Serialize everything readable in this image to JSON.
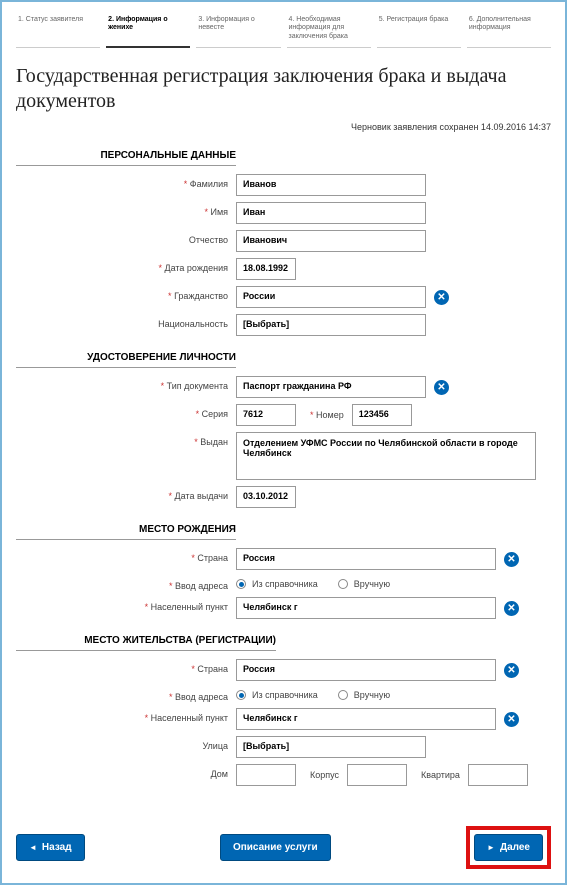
{
  "steps": [
    "1. Статус заявителя",
    "2. Информация о женихе",
    "3. Информация о невесте",
    "4. Необходимая информация для заключения брака",
    "5. Регистрация брака",
    "6. Дополнительная информация"
  ],
  "title": "Государственная регистрация заключения брака и выдача документов",
  "draft_saved": "Черновик заявления сохранен 14.09.2016 14:37",
  "sections": {
    "personal": "ПЕРСОНАЛЬНЫЕ ДАННЫЕ",
    "identity": "УДОСТОВЕРЕНИЕ ЛИЧНОСТИ",
    "birthplace": "МЕСТО РОЖДЕНИЯ",
    "residence": "МЕСТО ЖИТЕЛЬСТВА (РЕГИСТРАЦИИ)"
  },
  "labels": {
    "surname": "Фамилия",
    "name": "Имя",
    "patronymic": "Отчество",
    "birthdate": "Дата рождения",
    "citizenship": "Гражданство",
    "nationality": "Национальность",
    "doctype": "Тип документа",
    "series": "Серия",
    "number": "Номер",
    "issued_by": "Выдан",
    "issue_date": "Дата выдачи",
    "country": "Страна",
    "addr_input": "Ввод адреса",
    "locality": "Населенный пункт",
    "street": "Улица",
    "house": "Дом",
    "block": "Корпус",
    "flat": "Квартира"
  },
  "values": {
    "surname": "Иванов",
    "name": "Иван",
    "patronymic": "Иванович",
    "birthdate": "18.08.1992",
    "citizenship": "России",
    "nationality": "[Выбрать]",
    "doctype": "Паспорт гражданина РФ",
    "series": "7612",
    "number": "123456",
    "issued_by": "Отделением УФМС России по Челябинской области в городе Челябинск",
    "issue_date": "03.10.2012",
    "birth_country": "Россия",
    "birth_locality": "Челябинск г",
    "res_country": "Россия",
    "res_locality": "Челябинск г",
    "res_street": "[Выбрать]"
  },
  "radios": {
    "from_dir": "Из справочника",
    "manual": "Вручную"
  },
  "buttons": {
    "back": "Назад",
    "desc": "Описание услуги",
    "next": "Далее"
  }
}
